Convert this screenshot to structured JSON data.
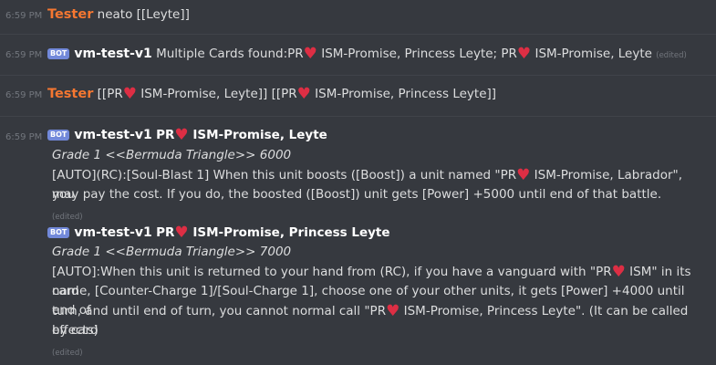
{
  "heart_glyph": "♥",
  "bot_tag": "BOT",
  "messages": [
    {
      "time": "6:59 PM",
      "author": "Tester",
      "text": "neato [[Leyte]]"
    },
    {
      "time": "6:59 PM",
      "author": "vm-test-v1",
      "text_a": "Multiple Cards found:PR",
      "text_b": " ISM-Promise, Princess Leyte; PR",
      "text_c": " ISM-Promise, Leyte",
      "edited": "(edited)"
    },
    {
      "time": "6:59 PM",
      "author": "Tester",
      "text_a": "[[PR",
      "text_b": " ISM-Promise, Leyte]] [[PR",
      "text_c": " ISM-Promise, Princess Leyte]]"
    },
    {
      "time": "6:59 PM",
      "author": "vm-test-v1",
      "title_a": "PR",
      "title_b": " ISM-Promise, Leyte",
      "grade": "Grade 1 <<Bermuda Triangle>> 6000",
      "effect_a": "[AUTO](RC):[Soul-Blast 1] When this unit boosts ([Boost]) a unit named \"PR",
      "effect_b": " ISM-Promise, Labrador\", you",
      "effect_c": "may pay the cost. If you do, the boosted ([Boost]) unit gets [Power] +5000 until end of that battle.",
      "edited": "(edited)"
    },
    {
      "author": "vm-test-v1",
      "title_a": "PR",
      "title_b": " ISM-Promise, Princess Leyte",
      "grade": "Grade 1 <<Bermuda Triangle>> 7000",
      "effect_a": "[AUTO]:When this unit is returned to your hand from (RC), if you have a vanguard with \"PR",
      "effect_b": " ISM\" in its card",
      "effect_c": "name, [Counter-Charge 1]/[Soul-Charge 1], choose one of your other units, it gets [Power] +4000 until end of",
      "effect_d": "turn, and until end of turn, you cannot normal call \"PR",
      "effect_e": " ISM-Promise, Princess Leyte\". (It can be called by card",
      "effect_f": "effects)",
      "edited": "(edited)"
    }
  ]
}
